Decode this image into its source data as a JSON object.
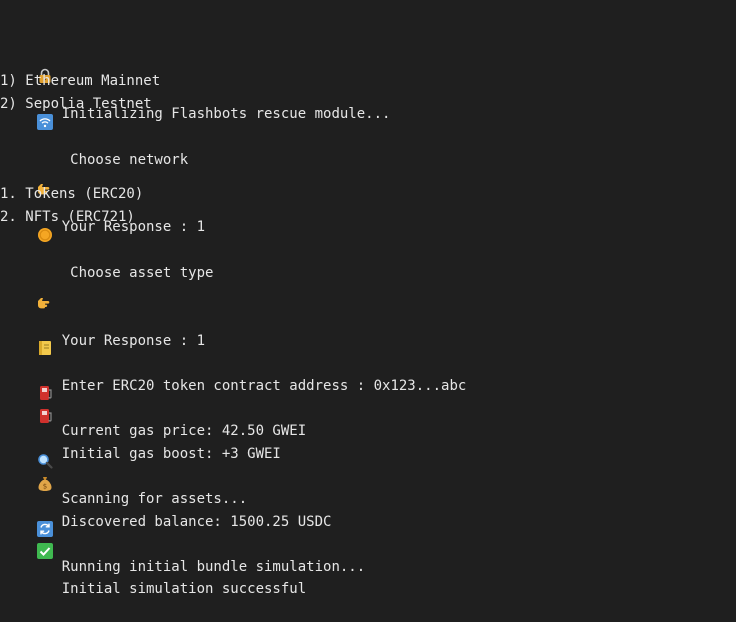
{
  "terminal": {
    "lines": [
      {
        "icon": "lock-icon",
        "text": "Initializing Flashbots rescue module..."
      },
      {
        "icon": "wifi-icon",
        "text": " Choose network"
      },
      {
        "text": "1) Ethereum Mainnet"
      },
      {
        "text": "2) Sepolia Testnet"
      },
      {
        "icon": "pointing-hand-icon",
        "text": "Your Response : 1"
      },
      {
        "icon": "coin-icon",
        "text": " Choose asset type"
      },
      {
        "text": "1. Tokens (ERC20)"
      },
      {
        "text": "2. NFTs (ERC721)"
      },
      {
        "icon": "pointing-hand-icon",
        "text": "Your Response : 1"
      },
      {
        "icon": "ledger-icon",
        "text": "Enter ERC20 token contract address : 0x123...abc"
      },
      {
        "icon": "fuel-pump-icon",
        "text": "Current gas price: 42.50 GWEI"
      },
      {
        "icon": "fuel-pump-icon",
        "text": "Initial gas boost: +3 GWEI"
      },
      {
        "icon": "magnifier-icon",
        "text": "Scanning for assets..."
      },
      {
        "icon": "money-bag-icon",
        "text": "Discovered balance: 1500.25 USDC"
      },
      {
        "icon": "refresh-icon",
        "text": "Running initial bundle simulation..."
      },
      {
        "icon": "check-icon",
        "text": "Initial simulation successful"
      }
    ]
  },
  "colors": {
    "background": "#1f1f1f",
    "text": "#e6e6e6",
    "wifi_blue": "#4a90d9",
    "check_green": "#3fb950",
    "coin_orange": "#f5a623",
    "fuel_red": "#d0312d",
    "ledger_yellow": "#f2c94c"
  }
}
